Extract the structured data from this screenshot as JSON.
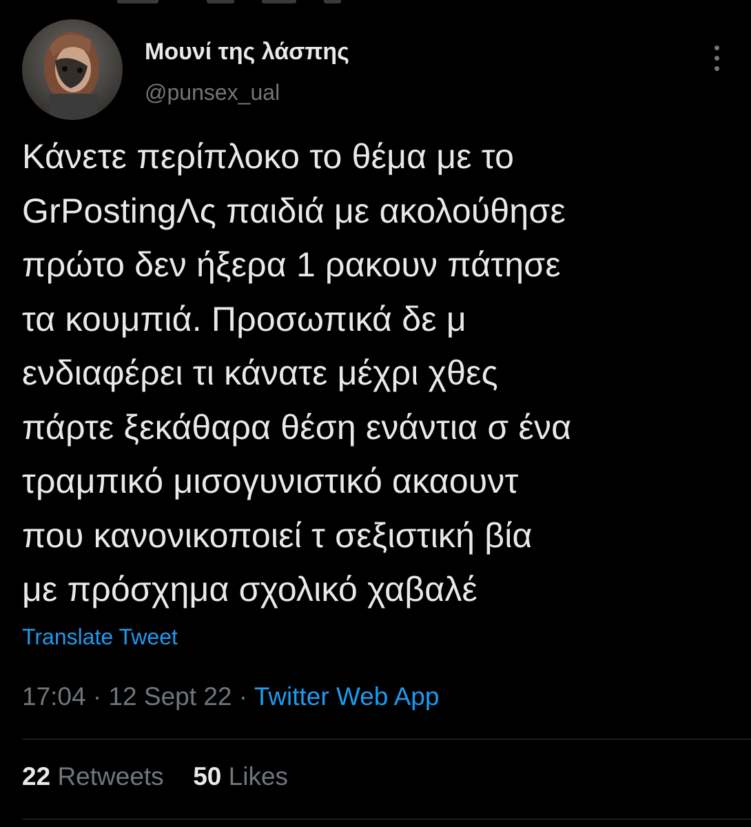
{
  "author": {
    "display_name": "Μουνί της λάσπης",
    "handle": "@punsex_ual",
    "avatar": "avatar-photo"
  },
  "tweet": {
    "lines": [
      "Κάνετε περίπλοκο το θέμα με το",
      "GrPostingΛς παιδιά με ακολούθησε",
      "πρώτο δεν ήξερα 1 ρακουν πάτησε",
      "τα κουμπιά. Προσωπικά δε μ",
      "ενδιαφέρει τι κάνατε μέχρι χθες",
      "πάρτε ξεκάθαρα θέση ενάντια σ ένα",
      "τραμπικό μισογυνιστικό ακαουντ",
      "που κανονικοποιεί τ σεξιστική βία",
      "με πρόσχημα σχολικό χαβαλέ"
    ],
    "translate_label": "Translate Tweet"
  },
  "meta": {
    "time": "17:04",
    "separator": "·",
    "date": "12 Sept 22",
    "source": "Twitter Web App"
  },
  "stats": {
    "retweets_count": "22",
    "retweets_label": "Retweets",
    "likes_count": "50",
    "likes_label": "Likes"
  },
  "icons": {
    "more": "more-vertical-icon"
  },
  "colors": {
    "background": "#000000",
    "text": "#e7e9ea",
    "secondary": "#71767b",
    "link": "#1d9bf0",
    "divider": "#2f3336"
  }
}
